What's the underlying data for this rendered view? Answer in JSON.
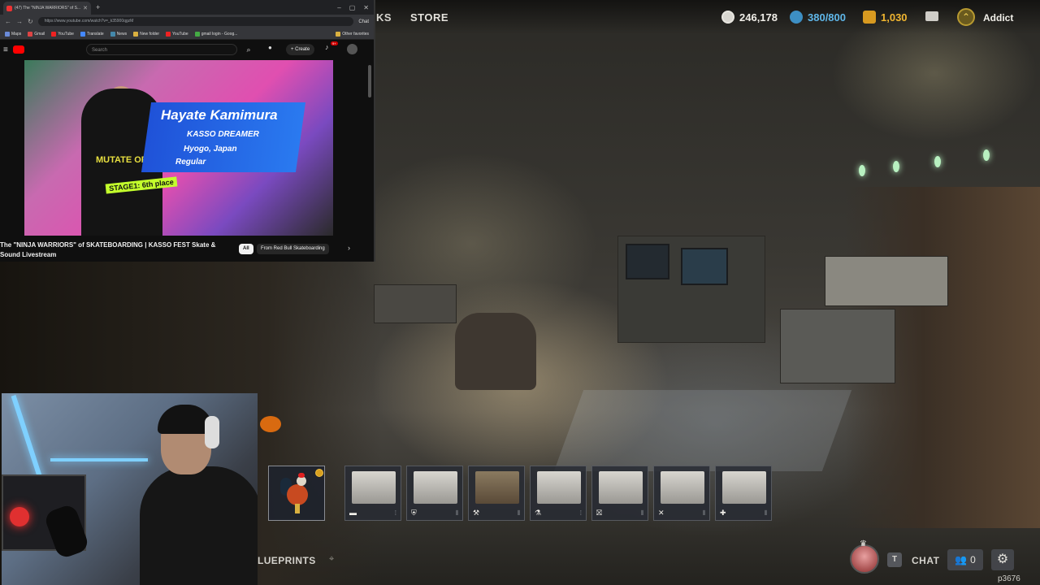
{
  "browser": {
    "tab_title": "(47) The \"NINJA WARRIORS\" of S...",
    "url": "https://www.youtube.com/watch?v=_k35900qgzM",
    "chat_extension": "Chat",
    "bookmarks": [
      "Maps",
      "Gmail",
      "YouTube",
      "Translate",
      "News",
      "New folder",
      "YouTube",
      "gmail login - Goog...",
      "Other favorites"
    ],
    "search_placeholder": "Search",
    "create_label": "Create",
    "notifications_badge": "9+",
    "video": {
      "athlete_name": "Hayate Kamimura",
      "team": "KASSO DREAMER",
      "hometown": "Hyogo, Japan",
      "stance": "Regular",
      "stage_result": "STAGE1: 6th place",
      "shirt_text": "MUTATE OR DIE"
    },
    "video_title": "The \"NINJA WARRIORS\" of SKATEBOARDING | KASSO FEST Skate & Sound Livestream",
    "chips": [
      "All",
      "From Red Bull Skateboarding"
    ]
  },
  "game_hud": {
    "nav": {
      "partial": "KS",
      "store": "STORE"
    },
    "currencies": [
      {
        "name": "scrap",
        "value": "246,178",
        "color": "#e8e6e0"
      },
      {
        "name": "premium",
        "value": "380/800",
        "color": "#5fb6e8"
      },
      {
        "name": "gold",
        "value": "1,030",
        "color": "#f0b530"
      }
    ],
    "player_name": "Addict",
    "rank_icon": "chevron-up-icon",
    "blueprints_label": "LUEPRINTS",
    "blueprint_slots": [
      {
        "item": "rooster",
        "category_icon": "",
        "new": true
      },
      {
        "item": "workbench-1",
        "category_icon": "▬"
      },
      {
        "item": "workbench-2",
        "category_icon": "⛨"
      },
      {
        "item": "workbench-3",
        "category_icon": "⚒"
      },
      {
        "item": "workbench-4",
        "category_icon": "⚗"
      },
      {
        "item": "workbench-5",
        "category_icon": "⛝"
      },
      {
        "item": "workbench-6",
        "category_icon": "✕"
      },
      {
        "item": "workbench-7",
        "category_icon": "✚"
      }
    ],
    "chat_key": "T",
    "chat_label": "CHAT",
    "friends_count": "0",
    "build_id": "p3676"
  }
}
